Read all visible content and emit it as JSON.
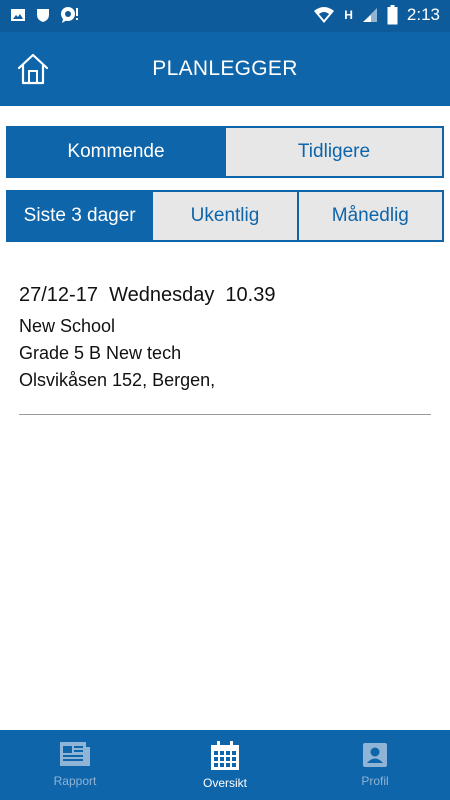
{
  "status_bar": {
    "time": "2:13",
    "network": "H",
    "left_icons": [
      "image-icon",
      "shield-icon",
      "chat-alert-icon"
    ],
    "right_icons": [
      "wifi-icon",
      "signal-icon",
      "battery-icon"
    ]
  },
  "header": {
    "title": "PLANLEGGER",
    "home_icon": "home-icon"
  },
  "period_tabs": {
    "upcoming": "Kommende",
    "previous": "Tidligere",
    "selected": "Kommende"
  },
  "range_tabs": {
    "last3": "Siste 3 dager",
    "weekly": "Ukentlig",
    "monthly": "Månedlig",
    "selected": "Siste 3 dager"
  },
  "entries": [
    {
      "datetime": "27/12-17  Wednesday  10.39",
      "school": "New School",
      "class": "Grade 5 B New tech",
      "address": "Olsvikåsen 152, Bergen,"
    }
  ],
  "bottom_nav": {
    "items": [
      {
        "label": "Rapport",
        "icon": "report-icon"
      },
      {
        "label": "Oversikt",
        "icon": "calendar-icon"
      },
      {
        "label": "Profil",
        "icon": "profile-icon"
      }
    ],
    "active": "Oversikt"
  },
  "colors": {
    "primary": "#0e65aa",
    "status_bar": "#0d5b9b",
    "inactive_tab": "#e7e7e7",
    "inactive_nav_label": "#8fb4d6"
  }
}
